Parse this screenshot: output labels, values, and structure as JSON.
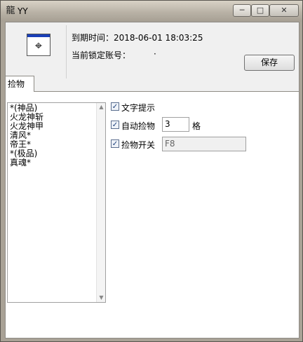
{
  "window": {
    "app_icon": "龍",
    "title": "YY",
    "controls": {
      "minimize": "─",
      "maximize": "□",
      "close": "✕"
    }
  },
  "header": {
    "logo_icon": "crosshair-icon",
    "logo_glyph": "⌖",
    "expiry_label": "到期时间：2018-06-01 18:03:25",
    "locked_account_label": "当前锁定账号：",
    "locked_account_value": "·",
    "save_button": "保存"
  },
  "tabs": [
    {
      "label": "捡物",
      "active": true
    }
  ],
  "item_list": [
    "*(神品)",
    "火龙神斩",
    "火龙神甲",
    "清风*",
    "帝王*",
    "*(极品)",
    "真魂*"
  ],
  "options": {
    "text_prompt": {
      "label": "文字提示",
      "checked": true,
      "check_mark": "✓"
    },
    "auto_pickup": {
      "label": "自动捡物",
      "checked": true,
      "check_mark": "✓",
      "value": "3",
      "unit": "格"
    },
    "pickup_switch": {
      "label": "捡物开关",
      "checked": true,
      "check_mark": "✓",
      "hotkey": "F8"
    }
  },
  "scroll": {
    "up": "▲",
    "down": "▼"
  },
  "colors": {
    "logo_bar": "#1a3fb8",
    "checkbox_border": "#5a6d8e"
  }
}
